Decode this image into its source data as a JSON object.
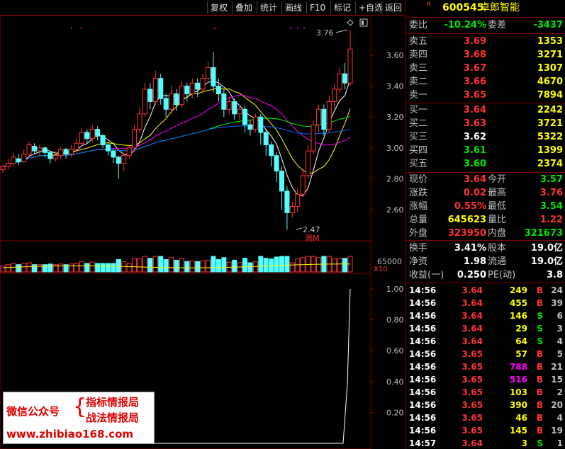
{
  "toolbar": {
    "buttons": [
      "复权",
      "叠加",
      "统计",
      "画线",
      "F10",
      "标记",
      "+自选",
      "返回"
    ]
  },
  "header": {
    "badge": "R",
    "code": "600545",
    "name": "卓郎智能"
  },
  "ratio": {
    "wb_label": "委比",
    "wb_value": "-10.24%",
    "wc_label": "委差",
    "wc_value": "-3437"
  },
  "asks": [
    {
      "label": "卖五",
      "price": "3.69",
      "vol": "1353"
    },
    {
      "label": "卖四",
      "price": "3.68",
      "vol": "3271"
    },
    {
      "label": "卖三",
      "price": "3.67",
      "vol": "1307"
    },
    {
      "label": "卖二",
      "price": "3.66",
      "vol": "4670"
    },
    {
      "label": "卖一",
      "price": "3.65",
      "vol": "7894"
    }
  ],
  "bids": [
    {
      "label": "买一",
      "price": "3.64",
      "vol": "2242",
      "color": "red"
    },
    {
      "label": "买二",
      "price": "3.63",
      "vol": "3721",
      "color": "red"
    },
    {
      "label": "买三",
      "price": "3.62",
      "vol": "5322",
      "color": "white"
    },
    {
      "label": "买四",
      "price": "3.61",
      "vol": "1399",
      "color": "green"
    },
    {
      "label": "买五",
      "price": "3.60",
      "vol": "2374",
      "color": "green"
    }
  ],
  "stats": [
    {
      "l1": "现价",
      "v1": "3.64",
      "c1": "red",
      "l2": "今开",
      "v2": "3.57",
      "c2": "green"
    },
    {
      "l1": "涨跌",
      "v1": "0.02",
      "c1": "red",
      "l2": "最高",
      "v2": "3.76",
      "c2": "red"
    },
    {
      "l1": "涨幅",
      "v1": "0.55%",
      "c1": "red",
      "l2": "最低",
      "v2": "3.54",
      "c2": "green"
    },
    {
      "l1": "总量",
      "v1": "645623",
      "c1": "yellow",
      "l2": "量比",
      "v2": "1.22",
      "c2": "red"
    },
    {
      "l1": "外盘",
      "v1": "323950",
      "c1": "red",
      "l2": "内盘",
      "v2": "321673",
      "c2": "green"
    }
  ],
  "fundamentals": [
    {
      "l1": "换手",
      "v1": "3.41%",
      "l2": "股本",
      "v2": "19.0亿"
    },
    {
      "l1": "净资",
      "v1": "1.98",
      "l2": "流通",
      "v2": "19.0亿"
    },
    {
      "l1": "收益(一)",
      "v1": "0.250",
      "l2": "PE(动)",
      "v2": "3.8"
    }
  ],
  "ticks": [
    {
      "time": "14:56",
      "price": "3.64",
      "pc": "red",
      "vol": "249",
      "vc": "yellow",
      "side": "B",
      "sc": "red",
      "n": "24"
    },
    {
      "time": "14:56",
      "price": "3.64",
      "pc": "red",
      "vol": "455",
      "vc": "yellow",
      "side": "B",
      "sc": "red",
      "n": "39"
    },
    {
      "time": "14:56",
      "price": "3.64",
      "pc": "red",
      "vol": "146",
      "vc": "yellow",
      "side": "S",
      "sc": "green",
      "n": "6"
    },
    {
      "time": "14:56",
      "price": "3.64",
      "pc": "red",
      "vol": "29",
      "vc": "yellow",
      "side": "S",
      "sc": "green",
      "n": "3"
    },
    {
      "time": "14:56",
      "price": "3.64",
      "pc": "red",
      "vol": "64",
      "vc": "yellow",
      "side": "S",
      "sc": "green",
      "n": "4"
    },
    {
      "time": "14:56",
      "price": "3.65",
      "pc": "red",
      "vol": "57",
      "vc": "yellow",
      "side": "B",
      "sc": "red",
      "n": "5"
    },
    {
      "time": "14:56",
      "price": "3.65",
      "pc": "red",
      "vol": "788",
      "vc": "magenta",
      "side": "B",
      "sc": "red",
      "n": "21"
    },
    {
      "time": "14:56",
      "price": "3.65",
      "pc": "red",
      "vol": "516",
      "vc": "magenta",
      "side": "B",
      "sc": "red",
      "n": "15"
    },
    {
      "time": "14:56",
      "price": "3.65",
      "pc": "red",
      "vol": "103",
      "vc": "yellow",
      "side": "B",
      "sc": "red",
      "n": "2"
    },
    {
      "time": "14:56",
      "price": "3.65",
      "pc": "red",
      "vol": "390",
      "vc": "yellow",
      "side": "B",
      "sc": "red",
      "n": "20"
    },
    {
      "time": "14:56",
      "price": "3.65",
      "pc": "red",
      "vol": "46",
      "vc": "yellow",
      "side": "B",
      "sc": "red",
      "n": "4"
    },
    {
      "time": "14:56",
      "price": "3.65",
      "pc": "red",
      "vol": "145",
      "vc": "yellow",
      "side": "B",
      "sc": "red",
      "n": "19"
    },
    {
      "time": "14:57",
      "price": "3.64",
      "pc": "red",
      "vol": "3",
      "vc": "yellow",
      "side": "S",
      "sc": "green",
      "n": "1"
    }
  ],
  "chart_data": {
    "type": "candlestick",
    "price_axis": [
      "3.60",
      "3.40",
      "3.20",
      "3.00",
      "2.80",
      "2.60"
    ],
    "high_label": "3.76",
    "low_label": "2.47",
    "low_tag": "测M",
    "volume_label": "65000",
    "volume_unit": "X10",
    "indicator_axis": [
      "1.00",
      "0.80",
      "0.60",
      "0.40",
      "0.20"
    ],
    "colors": {
      "up": "#ff3333",
      "down": "#54ffff",
      "ma5": "#ffffff",
      "ma10": "#ffff00",
      "ma20": "#ff00ff",
      "ma60": "#00ff00",
      "ma120": "#0066ff"
    },
    "candles": [
      [
        2.86,
        2.88,
        2.84,
        2.89
      ],
      [
        2.88,
        2.9,
        2.86,
        2.93
      ],
      [
        2.9,
        2.94,
        2.88,
        2.97
      ],
      [
        2.93,
        2.91,
        2.89,
        2.96
      ],
      [
        2.91,
        2.96,
        2.9,
        2.99
      ],
      [
        2.96,
        3.02,
        2.94,
        3.04
      ],
      [
        3.01,
        2.98,
        2.96,
        3.03
      ],
      [
        2.98,
        3.0,
        2.95,
        3.02
      ],
      [
        3.0,
        2.97,
        2.94,
        3.01
      ],
      [
        2.97,
        2.93,
        2.9,
        2.98
      ],
      [
        2.93,
        2.95,
        2.91,
        2.98
      ],
      [
        2.95,
        2.99,
        2.93,
        3.01
      ],
      [
        2.99,
        2.96,
        2.93,
        3.0
      ],
      [
        2.96,
        2.99,
        2.94,
        3.02
      ],
      [
        2.99,
        3.03,
        2.97,
        3.06
      ],
      [
        3.03,
        3.1,
        3.01,
        3.13
      ],
      [
        3.1,
        3.06,
        3.03,
        3.12
      ],
      [
        3.06,
        3.12,
        3.04,
        3.15
      ],
      [
        3.12,
        3.08,
        3.05,
        3.14
      ],
      [
        3.08,
        3.02,
        3.0,
        3.09
      ],
      [
        3.02,
        2.98,
        2.95,
        3.04
      ],
      [
        2.98,
        2.94,
        2.9,
        2.99
      ],
      [
        2.94,
        2.9,
        2.8,
        2.95
      ],
      [
        2.9,
        2.95,
        2.85,
        2.97
      ],
      [
        2.95,
        3.0,
        2.93,
        3.02
      ],
      [
        3.0,
        3.12,
        2.98,
        3.15
      ],
      [
        3.12,
        3.22,
        3.1,
        3.26
      ],
      [
        3.22,
        3.38,
        3.2,
        3.42
      ],
      [
        3.38,
        3.3,
        3.25,
        3.42
      ],
      [
        3.3,
        3.45,
        3.28,
        3.5
      ],
      [
        3.45,
        3.32,
        3.28,
        3.48
      ],
      [
        3.32,
        3.25,
        3.2,
        3.35
      ],
      [
        3.25,
        3.35,
        3.22,
        3.4
      ],
      [
        3.35,
        3.28,
        3.24,
        3.38
      ],
      [
        3.28,
        3.4,
        3.26,
        3.43
      ],
      [
        3.4,
        3.35,
        3.3,
        3.42
      ],
      [
        3.35,
        3.42,
        3.32,
        3.45
      ],
      [
        3.42,
        3.38,
        3.33,
        3.45
      ],
      [
        3.38,
        3.45,
        3.35,
        3.48
      ],
      [
        3.45,
        3.52,
        3.42,
        3.56
      ],
      [
        3.52,
        3.4,
        3.36,
        3.62
      ],
      [
        3.4,
        3.35,
        3.3,
        3.45
      ],
      [
        3.35,
        3.25,
        3.2,
        3.38
      ],
      [
        3.25,
        3.3,
        3.22,
        3.33
      ],
      [
        3.3,
        3.22,
        3.18,
        3.32
      ],
      [
        3.22,
        3.25,
        3.18,
        3.28
      ],
      [
        3.25,
        3.15,
        3.1,
        3.27
      ],
      [
        3.15,
        3.12,
        3.08,
        3.18
      ],
      [
        3.12,
        3.2,
        3.1,
        3.22
      ],
      [
        3.2,
        3.1,
        3.02,
        3.22
      ],
      [
        3.1,
        3.02,
        2.95,
        3.12
      ],
      [
        3.02,
        2.95,
        2.88,
        3.04
      ],
      [
        2.95,
        2.85,
        2.78,
        2.97
      ],
      [
        2.85,
        2.72,
        2.6,
        2.88
      ],
      [
        2.72,
        2.58,
        2.47,
        2.75
      ],
      [
        2.58,
        2.62,
        2.55,
        2.65
      ],
      [
        2.62,
        2.7,
        2.58,
        2.74
      ],
      [
        2.7,
        2.82,
        2.68,
        2.86
      ],
      [
        2.82,
        2.98,
        2.8,
        3.02
      ],
      [
        2.98,
        3.15,
        2.96,
        3.18
      ],
      [
        3.15,
        3.25,
        3.1,
        3.28
      ],
      [
        3.25,
        3.12,
        3.08,
        3.28
      ],
      [
        3.12,
        3.3,
        3.1,
        3.34
      ],
      [
        3.3,
        3.38,
        3.26,
        3.42
      ],
      [
        3.38,
        3.48,
        3.35,
        3.52
      ],
      [
        3.48,
        3.42,
        3.38,
        3.55
      ],
      [
        3.42,
        3.64,
        3.4,
        3.76
      ]
    ]
  },
  "watermark": {
    "left": "微信公众号",
    "line1": "指标情报局",
    "line2": "战法情报局",
    "url": "www.zhibiao168.com"
  }
}
